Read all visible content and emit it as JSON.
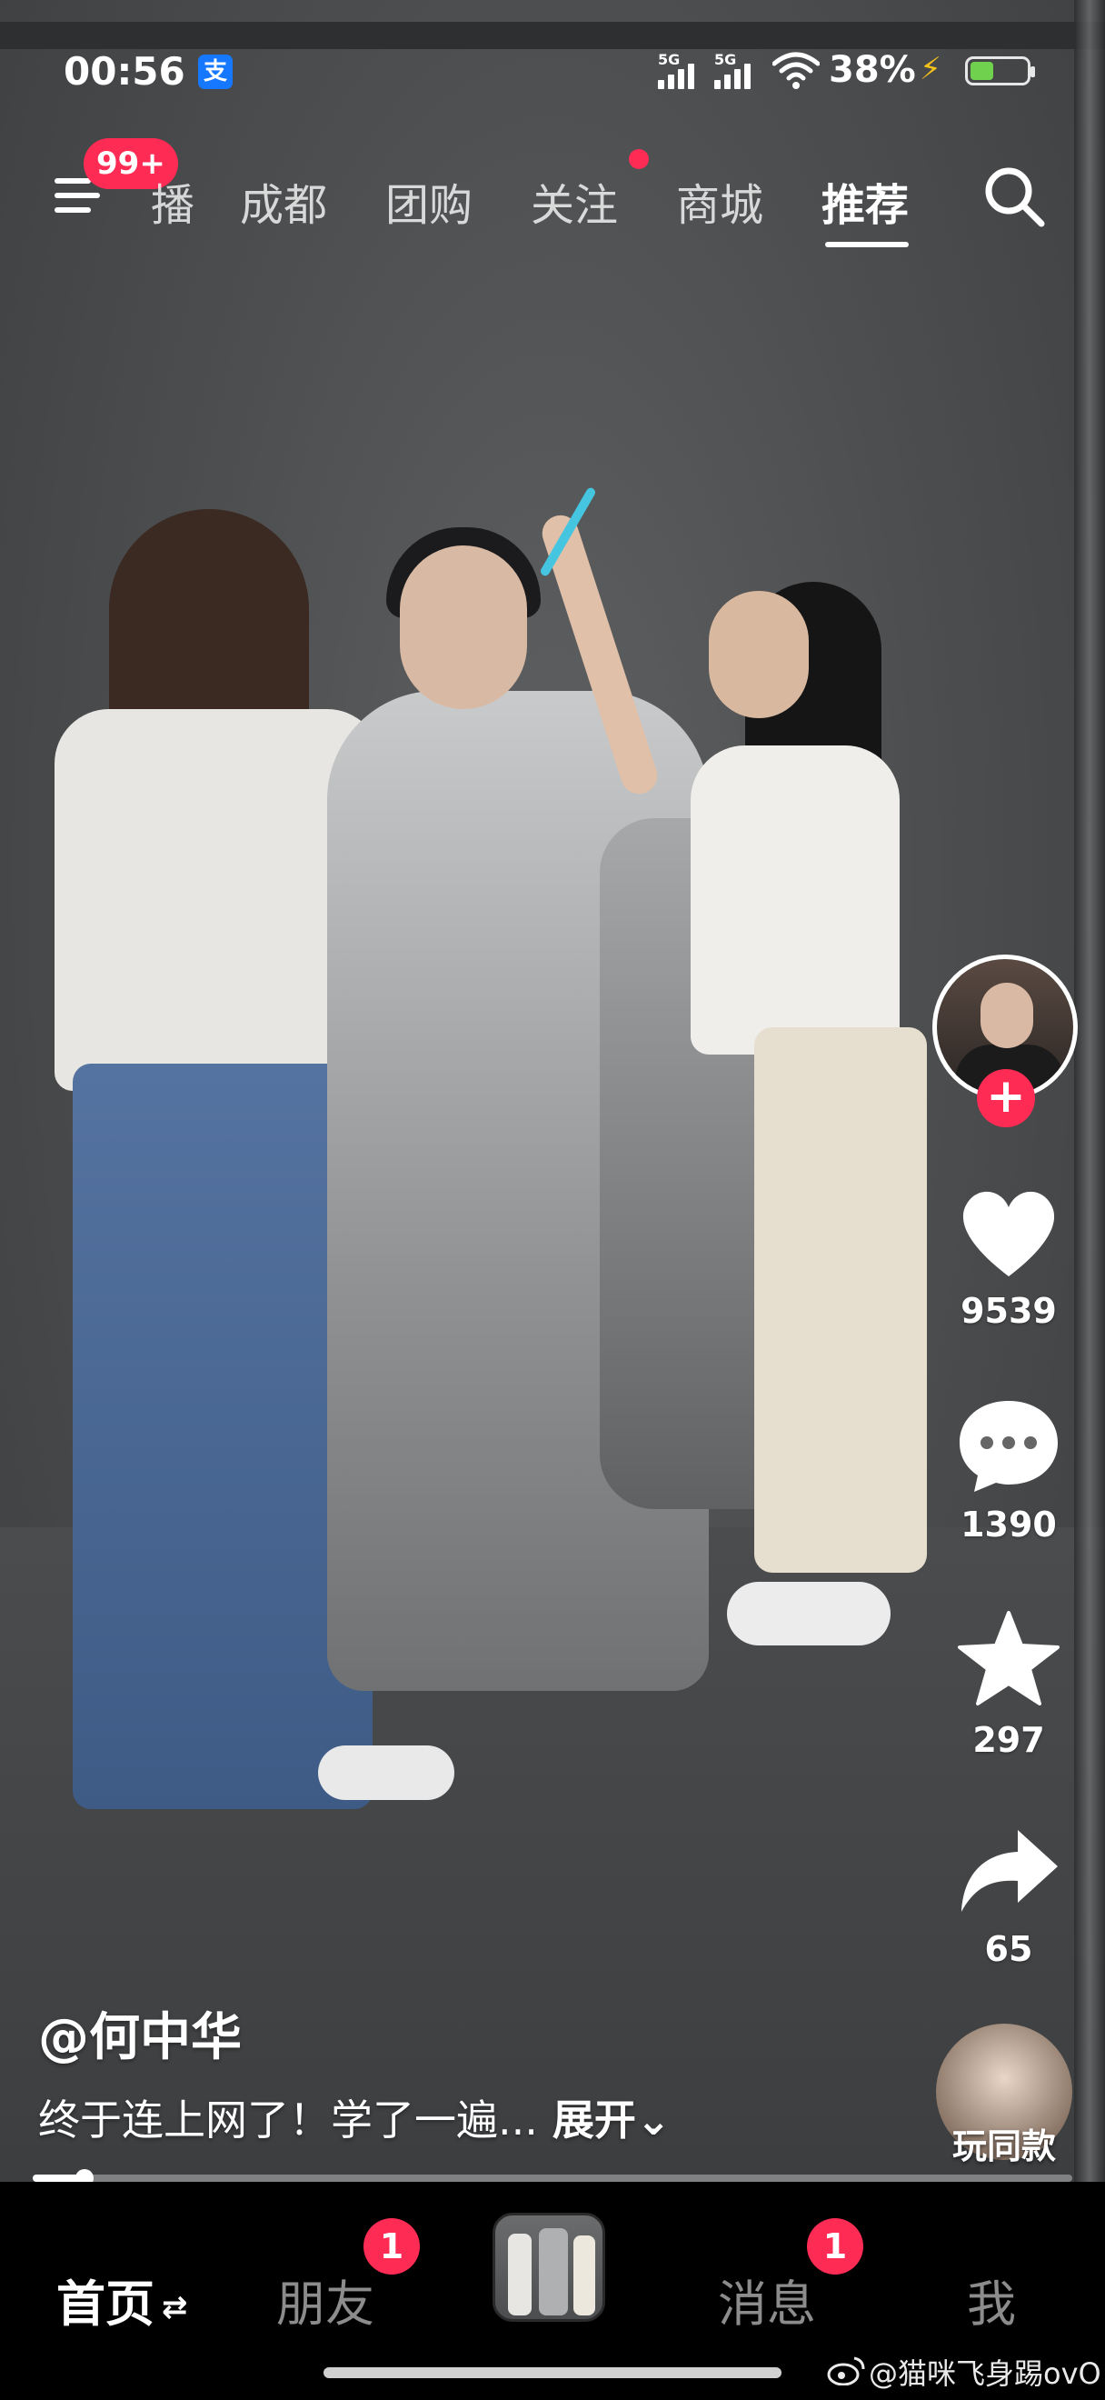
{
  "status_bar": {
    "time": "00:56",
    "pay_icon_glyph": "支",
    "signal_1": "5G",
    "signal_2": "5G",
    "battery_percent": "38%",
    "charging_glyph": "⚡"
  },
  "top_nav": {
    "menu_badge": "99+",
    "tabs": [
      {
        "label": "播"
      },
      {
        "label": "成都"
      },
      {
        "label": "团购"
      },
      {
        "label": "关注"
      },
      {
        "label": "商城"
      },
      {
        "label": "推荐"
      }
    ],
    "active_tab": "推荐"
  },
  "right_rail": {
    "follow_glyph": "+",
    "likes": "9539",
    "comments": "1390",
    "favorites": "297",
    "shares": "65",
    "music_label": "玩同款"
  },
  "video": {
    "author": "@何中华",
    "caption": "终于连上网了！学了一遍...",
    "expand_label": "展开",
    "expand_glyph": "⌄",
    "progress_fraction": 0.05
  },
  "bottom_nav": {
    "home": "首页",
    "home_swap_glyph": "⇄",
    "friends": "朋友",
    "friends_badge": "1",
    "messages": "消息",
    "messages_badge": "1",
    "me": "我"
  },
  "watermark": "@猫咪飞身踢ovO",
  "colors": {
    "accent_red": "#fe2c55",
    "pay_blue": "#1678ff",
    "battery_green": "#6fd14e"
  }
}
